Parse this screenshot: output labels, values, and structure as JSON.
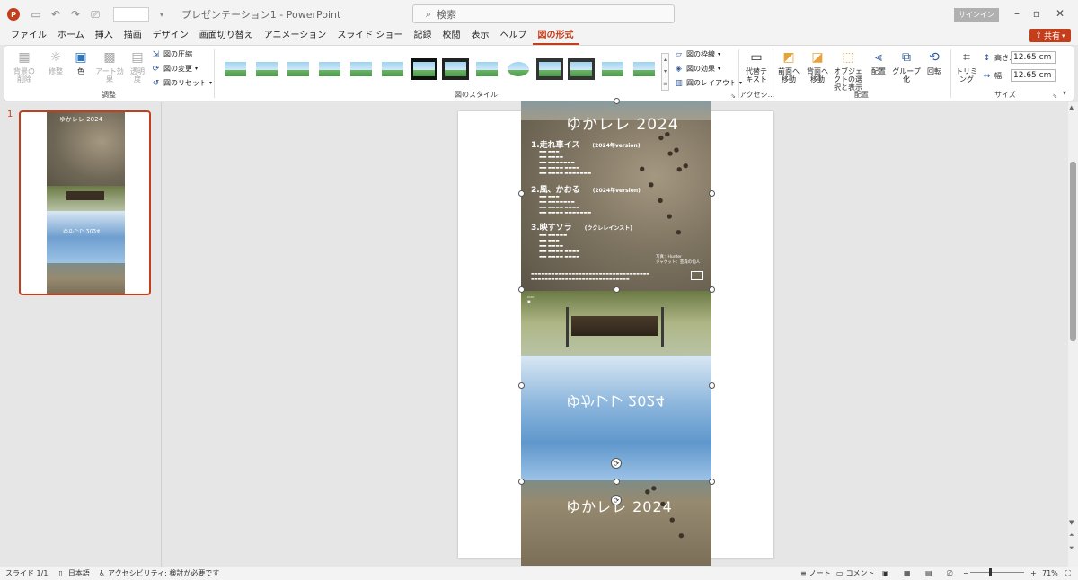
{
  "window": {
    "title": "プレゼンテーション1 - PowerPoint",
    "search_placeholder": "検索",
    "signin_label": "サインイン",
    "share_label": "共有",
    "app_icon": "P"
  },
  "tabs": [
    "ファイル",
    "ホーム",
    "挿入",
    "描画",
    "デザイン",
    "画面切り替え",
    "アニメーション",
    "スライド ショー",
    "記録",
    "校閲",
    "表示",
    "ヘルプ",
    "図の形式"
  ],
  "active_tab": "図の形式",
  "ribbon": {
    "adjust": {
      "remove_bg": "背景の削除",
      "corrections": "修整",
      "color": "色",
      "artistic": "アート効果",
      "transparency": "透明度",
      "compress": "図の圧縮",
      "change": "図の変更",
      "reset": "図のリセット",
      "label": "調整"
    },
    "styles": {
      "border": "図の枠線",
      "effects": "図の効果",
      "layout": "図のレイアウト",
      "label": "図のスタイル"
    },
    "accessibility": {
      "alt_text": "代替テキスト",
      "label": "アクセシ..."
    },
    "arrange": {
      "bring_forward": "前面へ移動",
      "send_backward": "背面へ移動",
      "selection_pane": "オブジェクトの選択と表示",
      "align": "配置",
      "group": "グループ化",
      "rotate": "回転",
      "label": "配置"
    },
    "size": {
      "crop": "トリミング",
      "height_label": "高さ:",
      "height_value": "12.65 cm",
      "width_label": "幅:",
      "width_value": "12.65 cm",
      "label": "サイズ"
    }
  },
  "thumbnail": {
    "slide_number": "1"
  },
  "slide_picture": {
    "cd_title": "ゆかレレ 2024",
    "tracks": [
      {
        "title": "1.走れ車イス",
        "version": "(2024年version)"
      },
      {
        "title": "2.風、かおる",
        "version": "(2024年version)"
      },
      {
        "title": "3.映すソラ",
        "version": "(ウクレレインスト)"
      }
    ],
    "mirrored_title": "ゆかレレ 2024",
    "photo_credit": "写真：Hunter",
    "jacket_credit": "ジャケット：芸森の仙人"
  },
  "statusbar": {
    "slide_info": "スライド 1/1",
    "language": "日本語",
    "accessibility": "アクセシビリティ: 検討が必要です",
    "notes": "ノート",
    "comments": "コメント",
    "zoom": "71%"
  }
}
